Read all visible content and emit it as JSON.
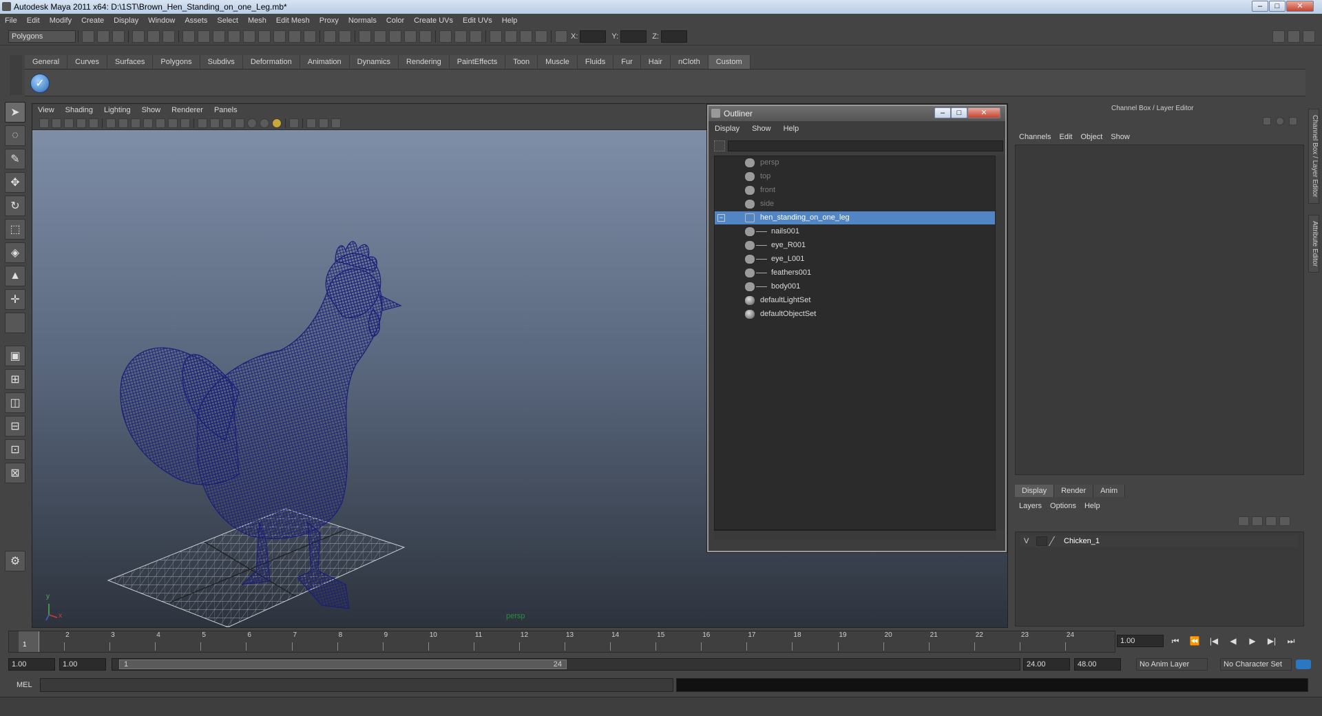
{
  "window": {
    "title": "Autodesk Maya 2011 x64: D:\\1ST\\Brown_Hen_Standing_on_one_Leg.mb*",
    "minimize": "–",
    "maximize": "□",
    "close": "✕"
  },
  "menubar": [
    "File",
    "Edit",
    "Modify",
    "Create",
    "Display",
    "Window",
    "Assets",
    "Select",
    "Mesh",
    "Edit Mesh",
    "Proxy",
    "Normals",
    "Color",
    "Create UVs",
    "Edit UVs",
    "Help"
  ],
  "statusline": {
    "mode": "Polygons",
    "x_label": "X:",
    "y_label": "Y:",
    "z_label": "Z:"
  },
  "shelf": {
    "tabs": [
      "General",
      "Curves",
      "Surfaces",
      "Polygons",
      "Subdivs",
      "Deformation",
      "Animation",
      "Dynamics",
      "Rendering",
      "PaintEffects",
      "Toon",
      "Muscle",
      "Fluids",
      "Fur",
      "Hair",
      "nCloth",
      "Custom"
    ],
    "active_tab": "Custom"
  },
  "viewport": {
    "menu": [
      "View",
      "Shading",
      "Lighting",
      "Show",
      "Renderer",
      "Panels"
    ],
    "camera": "persp",
    "axis_y": "y",
    "axis_x": "x",
    "wire_color": "#1a1e7a"
  },
  "outliner": {
    "title": "Outliner",
    "menu": [
      "Display",
      "Show",
      "Help"
    ],
    "items": [
      {
        "label": "persp",
        "icon": "camera-icon",
        "dim": true
      },
      {
        "label": "top",
        "icon": "camera-icon",
        "dim": true
      },
      {
        "label": "front",
        "icon": "camera-icon",
        "dim": true
      },
      {
        "label": "side",
        "icon": "camera-icon",
        "dim": true
      },
      {
        "label": "hen_standing_on_one_leg",
        "icon": "group-icon",
        "selected": true
      },
      {
        "label": "nails001",
        "icon": "mesh-icon",
        "child": true
      },
      {
        "label": "eye_R001",
        "icon": "mesh-icon",
        "child": true
      },
      {
        "label": "eye_L001",
        "icon": "mesh-icon",
        "child": true
      },
      {
        "label": "feathers001",
        "icon": "mesh-icon",
        "child": true
      },
      {
        "label": "body001",
        "icon": "mesh-icon",
        "child": true
      },
      {
        "label": "defaultLightSet",
        "icon": "set-icon"
      },
      {
        "label": "defaultObjectSet",
        "icon": "set-icon"
      }
    ]
  },
  "channelbox": {
    "header": "Channel Box / Layer Editor",
    "menu": [
      "Channels",
      "Edit",
      "Object",
      "Show"
    ],
    "side_tabs": [
      "Channel Box / Layer Editor",
      "Attribute Editor"
    ]
  },
  "layers": {
    "tabs": [
      "Display",
      "Render",
      "Anim"
    ],
    "active_tab": "Display",
    "menu": [
      "Layers",
      "Options",
      "Help"
    ],
    "rows": [
      {
        "visible": "V",
        "name": "Chicken_1"
      }
    ]
  },
  "timeslider": {
    "ticks": [
      "1",
      "2",
      "3",
      "4",
      "5",
      "6",
      "7",
      "8",
      "9",
      "10",
      "11",
      "12",
      "13",
      "14",
      "15",
      "16",
      "17",
      "18",
      "19",
      "20",
      "21",
      "22",
      "23",
      "24"
    ],
    "current_frame": "1.00",
    "current_marker": "1"
  },
  "range": {
    "start": "1.00",
    "playback_start": "1.00",
    "handle_start": "1",
    "handle_end": "24",
    "playback_end": "24.00",
    "end": "48.00",
    "anim_layer": "No Anim Layer",
    "character_set": "No Character Set"
  },
  "commandline": {
    "label": "MEL"
  }
}
